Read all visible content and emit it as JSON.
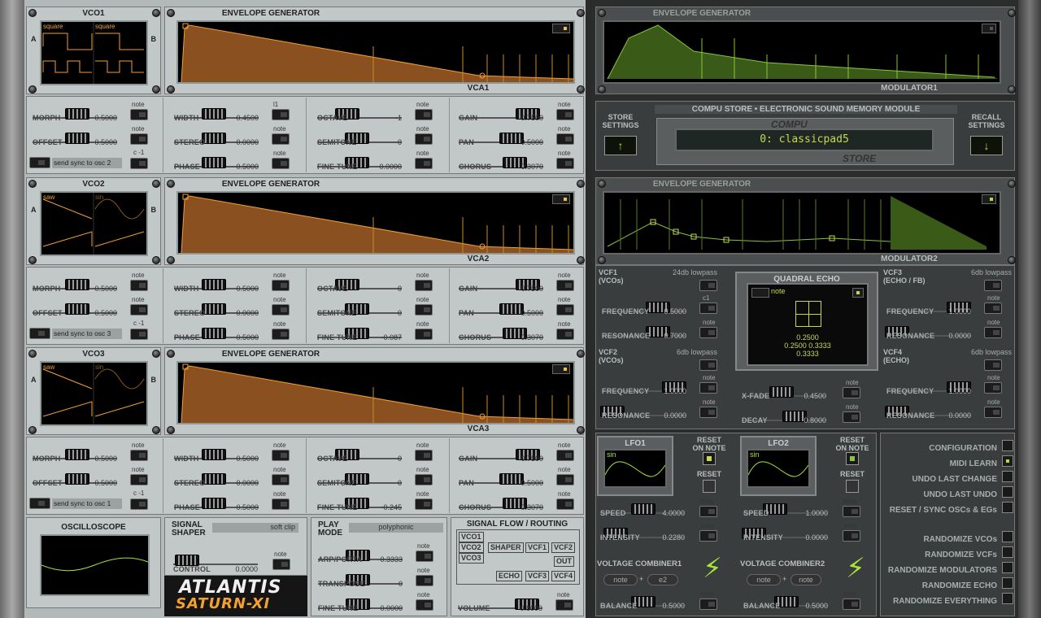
{
  "colors": {
    "orange": "#f2a033",
    "green": "#a8e33a",
    "lcd_text": "#c8d84c",
    "light_panel": "#c2c8c8",
    "dark_panel": "#3a3d3d"
  },
  "vco1": {
    "title": "VCO1",
    "side_a": "A",
    "side_b": "B",
    "wave_a": "square",
    "wave_b": "square",
    "morph": {
      "label": "MORPH",
      "value": "0.5000"
    },
    "offset": {
      "label": "OFFSET",
      "value": "0.5000"
    },
    "note1": "note",
    "note2": "note",
    "c_label": "c -1",
    "sync_label": "send sync to osc 2"
  },
  "vco2": {
    "title": "VCO2",
    "side_a": "A",
    "side_b": "B",
    "wave_a": "saw",
    "wave_b": "sin",
    "morph": {
      "label": "MORPH",
      "value": "0.5000"
    },
    "offset": {
      "label": "OFFSET",
      "value": "0.5000"
    },
    "note1": "note",
    "note2": "note",
    "c_label": "c -1",
    "sync_label": "send sync to osc 3"
  },
  "vco3": {
    "title": "VCO3",
    "side_a": "A",
    "side_b": "B",
    "wave_a": "saw",
    "wave_b": "sin",
    "morph": {
      "label": "MORPH",
      "value": "0.5000"
    },
    "offset": {
      "label": "OFFSET",
      "value": "0.5000"
    },
    "note1": "note",
    "note2": "note",
    "c_label": "c -1",
    "sync_label": "send sync to osc 1"
  },
  "env1": {
    "title": "ENVELOPE GENERATOR",
    "footer": "VCA1"
  },
  "env2": {
    "title": "ENVELOPE GENERATOR",
    "footer": "VCA2"
  },
  "env3": {
    "title": "ENVELOPE GENERATOR",
    "footer": "VCA3"
  },
  "osc1_row": {
    "width": {
      "label": "WIDTH",
      "value": "0.4500"
    },
    "stereo": {
      "label": "STEREO",
      "value": "0.0000"
    },
    "phase": {
      "label": "PHASE",
      "value": "0.5000"
    },
    "octave": {
      "label": "OCTAVE",
      "value": "-1"
    },
    "semitone": {
      "label": "SEMITONE",
      "value": "0"
    },
    "finetune": {
      "label": "FINE TUNE",
      "value": "0.0000"
    },
    "gain": {
      "label": "GAIN",
      "value": "0.7500"
    },
    "pan": {
      "label": "PAN",
      "value": "0.5000"
    },
    "chorus": {
      "label": "CHORUS",
      "value": "0.3070"
    },
    "l1": "l1",
    "note": "note"
  },
  "osc2_row": {
    "width": {
      "label": "WIDTH",
      "value": "0.5000"
    },
    "stereo": {
      "label": "STEREO",
      "value": "0.0000"
    },
    "phase": {
      "label": "PHASE",
      "value": "0.5000"
    },
    "octave": {
      "label": "OCTAVE",
      "value": "0"
    },
    "semitone": {
      "label": "SEMITONE",
      "value": "0"
    },
    "finetune": {
      "label": "FINE TUNE",
      "value": "-0.087"
    },
    "gain": {
      "label": "GAIN",
      "value": "0.7500"
    },
    "pan": {
      "label": "PAN",
      "value": "0.5000"
    },
    "chorus": {
      "label": "CHORUS",
      "value": "0.3070"
    },
    "note": "note"
  },
  "osc3_row": {
    "width": {
      "label": "WIDTH",
      "value": "0.5000"
    },
    "stereo": {
      "label": "STEREO",
      "value": "0.0000"
    },
    "phase": {
      "label": "PHASE",
      "value": "0.5000"
    },
    "octave": {
      "label": "OCTAVE",
      "value": "0"
    },
    "semitone": {
      "label": "SEMITONE",
      "value": "0"
    },
    "finetune": {
      "label": "FINE TUNE",
      "value": "-0.245"
    },
    "gain": {
      "label": "GAIN",
      "value": "0.7500"
    },
    "pan": {
      "label": "PAN",
      "value": "0.5000"
    },
    "chorus": {
      "label": "CHORUS",
      "value": "0.3070"
    },
    "note": "note"
  },
  "oscilloscope": {
    "title": "OSCILLOSCOPE"
  },
  "shaper": {
    "title1": "SIGNAL",
    "title2": "SHAPER",
    "mode": "soft clip",
    "control": {
      "label": "CONTROL",
      "value": "0.0000"
    },
    "note": "note"
  },
  "play": {
    "title1": "PLAY",
    "title2": "MODE",
    "mode": "polyphonic",
    "arp": {
      "label": "ARP/PORTA",
      "value": "0.3333"
    },
    "transpose": {
      "label": "TRANSPOSE",
      "value": "0"
    },
    "finetune": {
      "label": "FINE TUNE",
      "value": "0.0000"
    },
    "note": "note"
  },
  "routing": {
    "title": "SIGNAL FLOW / ROUTING",
    "boxes": [
      "VCO1",
      "VCO2",
      "VCO3",
      "SHAPER",
      "VCF1",
      "VCF2",
      "OUT",
      "ECHO",
      "VCF3",
      "VCF4"
    ],
    "volume": {
      "label": "VOLUME",
      "value": "0.8000"
    },
    "note": "note"
  },
  "brand": {
    "line1": "ATLANTIS",
    "line2": "SATURN-XI"
  },
  "mod1": {
    "title": "ENVELOPE GENERATOR",
    "footer": "MODULATOR1"
  },
  "mod2": {
    "title": "ENVELOPE GENERATOR",
    "footer": "MODULATOR2"
  },
  "compu": {
    "title": "COMPU STORE • ELECTRONIC SOUND MEMORY MODULE",
    "logo_top": "COMPU",
    "logo_bottom": "STORE",
    "preset": "0: classicpad5",
    "store_1": "STORE",
    "store_2": "SETTINGS",
    "recall_1": "RECALL",
    "recall_2": "SETTINGS"
  },
  "vcf1": {
    "title": "VCF1",
    "sub": "(VCOs)",
    "type": "24db lowpass",
    "frequency": {
      "label": "FREQUENCY",
      "value": "0.5000"
    },
    "resonance": {
      "label": "RESONANCE",
      "value": "0.7000"
    },
    "c1": "c1",
    "note": "note"
  },
  "vcf2": {
    "title": "VCF2",
    "sub": "(VCOs)",
    "type": "6db lowpass",
    "frequency": {
      "label": "FREQUENCY",
      "value": "1.0000"
    },
    "resonance": {
      "label": "RESONANCE",
      "value": "0.0000"
    },
    "note": "note"
  },
  "vcf3": {
    "title": "VCF3",
    "sub": "(ECHO / FB)",
    "type": "6db lowpass",
    "frequency": {
      "label": "FREQUENCY",
      "value": "1.0000"
    },
    "resonance": {
      "label": "RESONANCE",
      "value": "0.0000"
    },
    "note": "note"
  },
  "vcf4": {
    "title": "VCF4",
    "sub": "(ECHO)",
    "type": "6db lowpass",
    "frequency": {
      "label": "FREQUENCY",
      "value": "1.0000"
    },
    "resonance": {
      "label": "RESONANCE",
      "value": "0.0000"
    },
    "note": "note"
  },
  "echo": {
    "title": "QUADRAL ECHO",
    "note": "note",
    "v1": "0.2500",
    "v2": "0.2500 0.3333",
    "v3": "0.3333",
    "xfade": {
      "label": "X-FADE",
      "value": "0.4500"
    },
    "decay": {
      "label": "DECAY",
      "value": "0.8000"
    }
  },
  "lfo1": {
    "title": "LFO1",
    "wave": "sin",
    "reset_on_1": "RESET",
    "reset_on_2": "ON NOTE",
    "reset": "RESET",
    "speed": {
      "label": "SPEED",
      "value": "4.0000"
    },
    "intensity": {
      "label": "INTENSITY",
      "value": "0.2280"
    },
    "note": "note"
  },
  "lfo2": {
    "title": "LFO2",
    "wave": "sin",
    "reset_on_1": "RESET",
    "reset_on_2": "ON NOTE",
    "reset": "RESET",
    "speed": {
      "label": "SPEED",
      "value": "1.0000"
    },
    "intensity": {
      "label": "INTENSITY",
      "value": "0.0000"
    },
    "note": "note"
  },
  "vc1": {
    "title": "VOLTAGE COMBINER1",
    "in_a": "note",
    "plus": "+",
    "in_b": "e2",
    "balance": {
      "label": "BALANCE",
      "value": "0.5000"
    },
    "note": "note"
  },
  "vc2": {
    "title": "VOLTAGE COMBINER2",
    "in_a": "note",
    "plus": "+",
    "in_b": "note",
    "balance": {
      "label": "BALANCE",
      "value": "0.5000"
    },
    "note": "note"
  },
  "config": {
    "items": [
      "CONFIGURATION",
      "MIDI LEARN",
      "UNDO LAST CHANGE",
      "UNDO LAST UNDO",
      "RESET / SYNC OSCs & EGs"
    ],
    "random": [
      "RANDOMIZE VCOs",
      "RANDOMIZE VCFs",
      "RANDOMIZE MODULATORS",
      "RANDOMIZE ECHO",
      "RANDOMIZE EVERYTHING"
    ]
  }
}
